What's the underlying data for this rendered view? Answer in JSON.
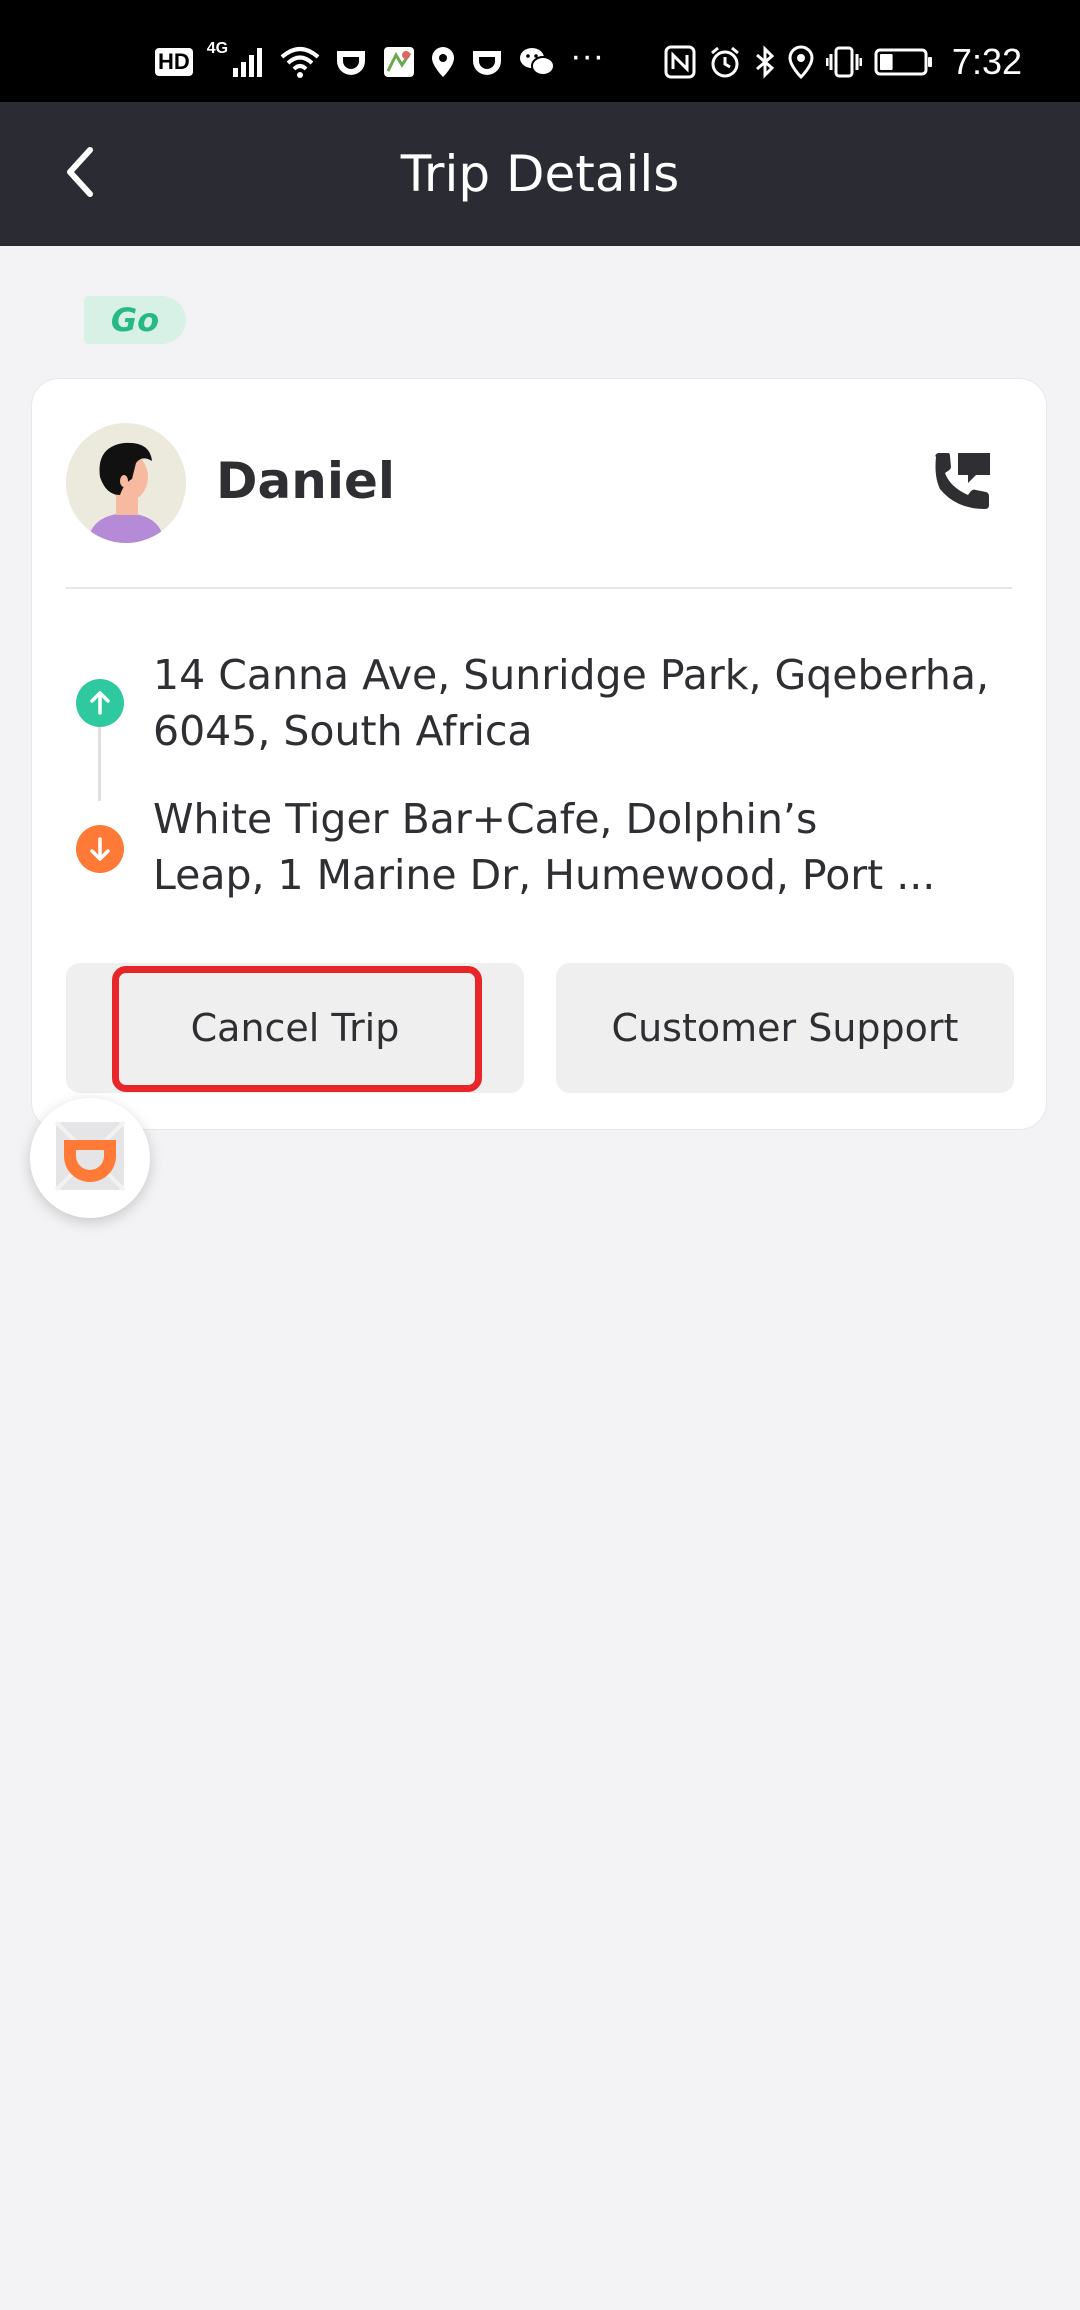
{
  "status_bar": {
    "hd_label": "HD",
    "network_label": "4G",
    "more_label": "···",
    "time": "7:32",
    "left_icons": [
      "hd-badge",
      "signal-icon",
      "wifi-icon",
      "didi-notification-icon",
      "maps-icon",
      "location-icon",
      "didi-notification-icon",
      "wechat-icon"
    ],
    "right_icons": [
      "nfc-icon",
      "alarm-icon",
      "bluetooth-icon",
      "location-icon",
      "vibrate-icon",
      "battery-icon"
    ],
    "battery_level": 0.3
  },
  "header": {
    "title": "Trip Details",
    "back_icon": "chevron-left-icon"
  },
  "service_badge": "Go",
  "driver": {
    "name": "Daniel",
    "avatar": "avatar-illustration",
    "call_icon": "phone-message-icon"
  },
  "route": {
    "pickup": "14 Canna Ave, Sunridge Park, Gqeberha, 6045, South Africa",
    "dropoff_line1": "White Tiger Bar+Cafe, Dolphin’s",
    "dropoff_line2": "Leap, 1 Marine Dr, Humewood, Port ..."
  },
  "actions": {
    "cancel_label": "Cancel Trip",
    "support_label": "Customer Support"
  },
  "floating_button_icon": "didi-logo-icon",
  "colors": {
    "status_bar_bg": "#000000",
    "app_bar_bg": "#2b2c33",
    "page_bg": "#f3f3f5",
    "go_badge_bg": "#d8f1e6",
    "go_badge_text": "#26b986",
    "pickup_dot": "#2fc9a0",
    "dropoff_dot": "#ff7a37",
    "highlight": "#e8262a",
    "didi_orange": "#ff7a37"
  }
}
